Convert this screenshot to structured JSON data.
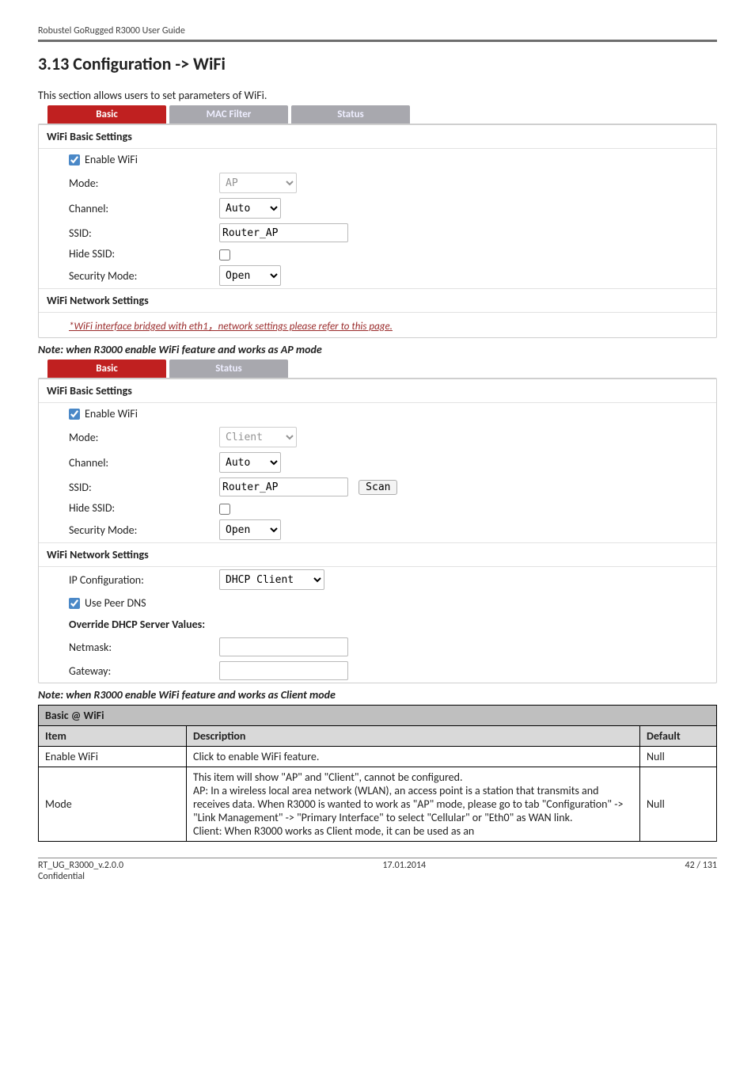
{
  "running_head": "Robustel GoRugged R3000 User Guide",
  "heading": "3.13  Configuration -> WiFi",
  "intro": "This section allows users to set parameters of WiFi.",
  "ap": {
    "tabs": {
      "basic": "Basic",
      "mac": "MAC Filter",
      "status": "Status"
    },
    "section1": "WiFi Basic Settings",
    "enable_label": "Enable WiFi",
    "mode_label": "Mode:",
    "mode_value": "AP",
    "channel_label": "Channel:",
    "channel_value": "Auto",
    "ssid_label": "SSID:",
    "ssid_value": "Router_AP",
    "hide_label": "Hide SSID:",
    "sec_label": "Security Mode:",
    "sec_value": "Open",
    "section2": "WiFi Network Settings",
    "link": "*WiFi interface bridged with eth1，network settings please refer to this page."
  },
  "note1": "Note: when R3000 enable WiFi feature and works as AP mode",
  "note_prefix": "Note",
  "note1_rest": ": when R3000 enable WiFi feature and works as AP mode",
  "client": {
    "tabs": {
      "basic": "Basic",
      "status": "Status"
    },
    "section1": "WiFi Basic Settings",
    "enable_label": "Enable WiFi",
    "mode_label": "Mode:",
    "mode_value": "Client",
    "channel_label": "Channel:",
    "channel_value": "Auto",
    "ssid_label": "SSID:",
    "ssid_value": "Router_AP",
    "scan": "Scan",
    "hide_label": "Hide SSID:",
    "sec_label": "Security Mode:",
    "sec_value": "Open",
    "section2": "WiFi Network Settings",
    "ipcfg_label": "IP Configuration:",
    "ipcfg_value": "DHCP Client",
    "peer_label": "Use Peer DNS",
    "section3": "Override DHCP Server Values:",
    "netmask_label": "Netmask:",
    "netmask_value": "",
    "gateway_label": "Gateway:",
    "gateway_value": ""
  },
  "note2_rest": ": when R3000 enable WiFi feature and works as Client mode",
  "table": {
    "title": "Basic @ WiFi",
    "h_item": "Item",
    "h_desc": "Description",
    "h_default": "Default",
    "r1_item": "Enable WiFi",
    "r1_desc": "Click to enable WiFi feature.",
    "r1_def": "Null",
    "r2_item": "Mode",
    "r2_l1": "This item will show \"AP\" and \"Client\", cannot be configured.",
    "r2_l2": "AP: In a wireless local area network (WLAN), an access point is a station that transmits and receives data. When R3000 is wanted to work as \"AP\" mode, please go to tab \"Configuration\" -> \"Link Management\" -> \"Primary Interface\" to select \"Cellular\" or \"Eth0\" as WAN link.",
    "r2_l3": "Client: When R3000 works as Client mode, it can be used as an",
    "r2_def": "Null"
  },
  "footer": {
    "left": "RT_UG_R3000_v.2.0.0",
    "left2": "Confidential",
    "center": "17.01.2014",
    "right": "42 / 131"
  }
}
